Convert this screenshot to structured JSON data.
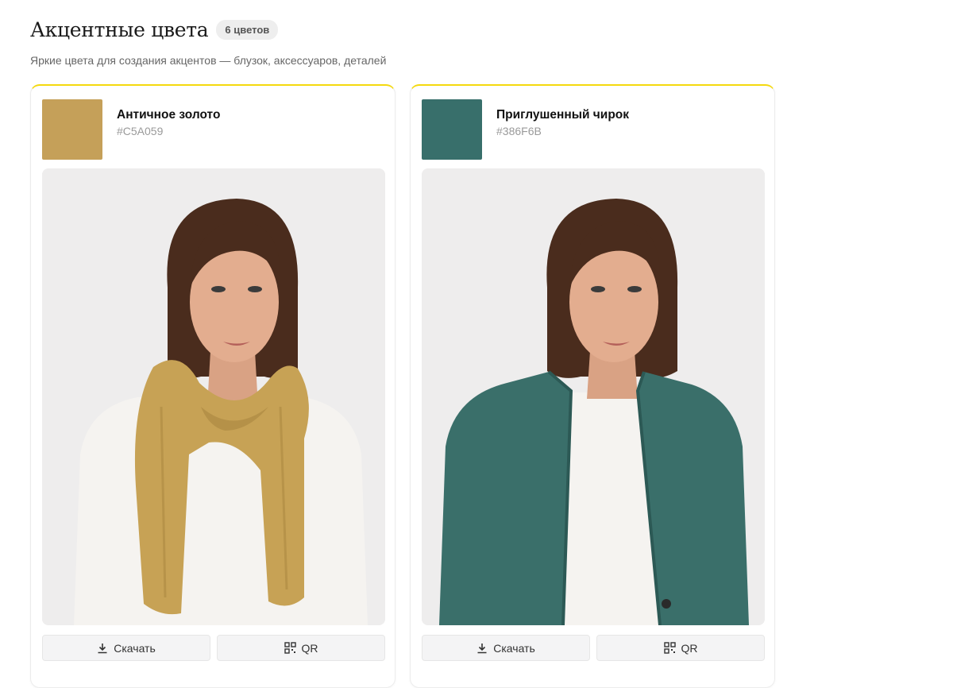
{
  "section": {
    "title": "Акцентные цвета",
    "count_badge": "6 цветов",
    "subtitle": "Яркие цвета для создания акцентов — блузок, аксессуаров, деталей"
  },
  "cards": [
    {
      "color_name": "Античное золото",
      "hex": "#C5A059",
      "swatch_color": "#C5A059",
      "garment": "scarf",
      "download_label": "Скачать",
      "qr_label": "QR"
    },
    {
      "color_name": "Приглушенный чирок",
      "hex": "#386F6B",
      "swatch_color": "#386F6B",
      "garment": "cardigan",
      "download_label": "Скачать",
      "qr_label": "QR"
    }
  ],
  "icons": {
    "download": "download-icon",
    "qr": "qr-code-icon"
  },
  "colors": {
    "accent_border": "#f4d90e",
    "photo_bg": "#eeeded"
  }
}
